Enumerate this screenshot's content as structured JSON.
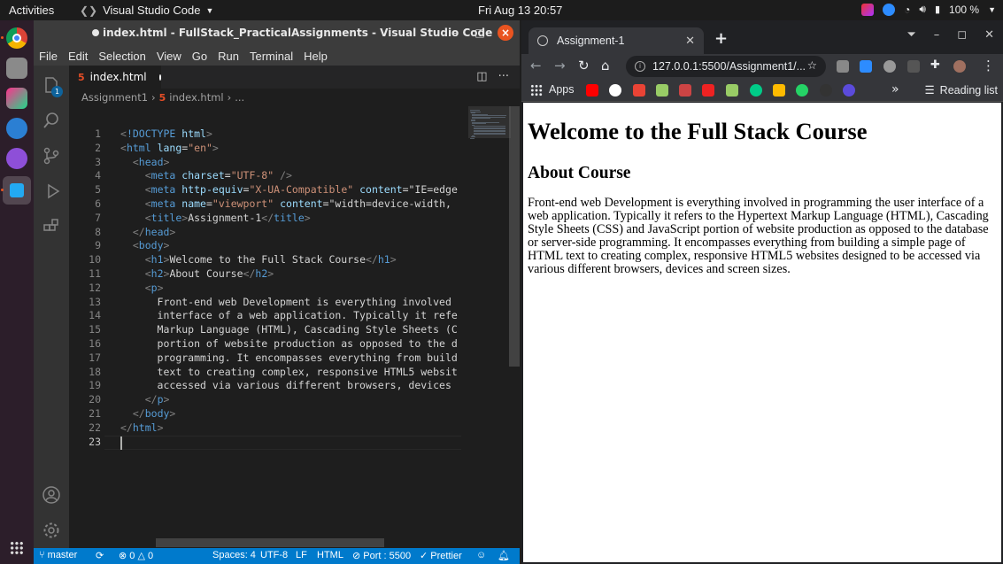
{
  "topbar": {
    "activities": "Activities",
    "app_name": "Visual Studio Code",
    "clock": "Fri Aug 13  20:57",
    "battery": "100 %"
  },
  "vscode": {
    "window_title": "index.html - FullStack_PracticalAssignments - Visual Studio Code",
    "menu": [
      "File",
      "Edit",
      "Selection",
      "View",
      "Go",
      "Run",
      "Terminal",
      "Help"
    ],
    "explorer_badge": "1",
    "tab_label": "index.html",
    "breadcrumb": [
      "Assignment1",
      "index.html",
      "..."
    ],
    "code_lines": [
      "<!DOCTYPE html>",
      "<html lang=\"en\">",
      "  <head>",
      "    <meta charset=\"UTF-8\" />",
      "    <meta http-equiv=\"X-UA-Compatible\" content=\"IE=edge",
      "    <meta name=\"viewport\" content=\"width=device-width, ",
      "    <title>Assignment-1</title>",
      "  </head>",
      "  <body>",
      "    <h1>Welcome to the Full Stack Course</h1>",
      "    <h2>About Course</h2>",
      "    <p>",
      "      Front-end web Development is everything involved ",
      "      interface of a web application. Typically it refe",
      "      Markup Language (HTML), Cascading Style Sheets (C",
      "      portion of website production as opposed to the d",
      "      programming. It encompasses everything from build",
      "      text to creating complex, responsive HTML5 websit",
      "      accessed via various different browsers, devices ",
      "    </p>",
      "  </body>",
      "</html>",
      ""
    ],
    "status": {
      "branch": "master",
      "problems": "0",
      "warnings": "0",
      "spaces": "Spaces: 4",
      "encoding": "UTF-8",
      "eol": "LF",
      "language": "HTML",
      "port": "Port : 5500",
      "prettier": "Prettier"
    }
  },
  "chrome": {
    "tab_title": "Assignment-1",
    "url": "127.0.0.1:5500/Assignment1/...",
    "apps_label": "Apps",
    "reading_list": "Reading list",
    "more_bookmarks": "»"
  },
  "webpage": {
    "h1": "Welcome to the Full Stack Course",
    "h2": "About Course",
    "paragraph": "Front-end web Development is everything involved in programming the user interface of a web application. Typically it refers to the Hypertext Markup Language (HTML), Cascading Style Sheets (CSS) and JavaScript portion of website production as opposed to the database or server-side programming. It encompasses everything from building a simple page of HTML text to creating complex, responsive HTML5 websites designed to be accessed via various different browsers, devices and screen sizes."
  },
  "colors": {
    "vscode_accent": "#007acc",
    "ubuntu_orange": "#e95420",
    "html_icon": "#e44d26"
  }
}
